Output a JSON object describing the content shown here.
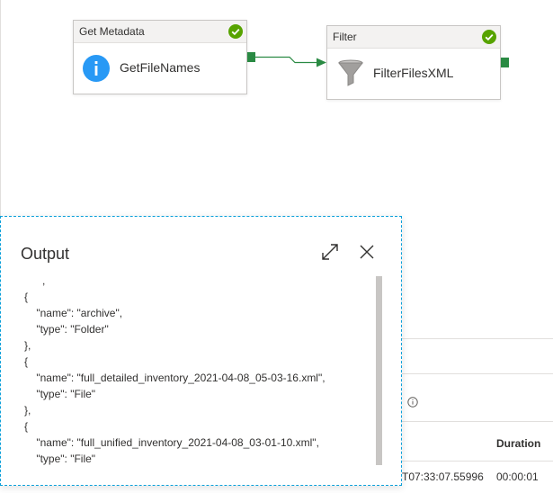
{
  "pipeline": {
    "activities": [
      {
        "type_label": "Get Metadata",
        "name": "GetFileNames",
        "status": "succeeded",
        "icon": "info-icon"
      },
      {
        "type_label": "Filter",
        "name": "FilterFilesXML",
        "status": "succeeded",
        "icon": "funnel-icon"
      }
    ]
  },
  "run_table": {
    "duration_header": "Duration",
    "row": {
      "time_fragment": "T07:33:07.55996",
      "duration": "00:00:01"
    }
  },
  "output_panel": {
    "title": "Output",
    "json_text": "      ,\n{\n    \"name\": \"archive\",\n    \"type\": \"Folder\"\n},\n{\n    \"name\": \"full_detailed_inventory_2021-04-08_05-03-16.xml\",\n    \"type\": \"File\"\n},\n{\n    \"name\": \"full_unified_inventory_2021-04-08_03-01-10.xml\",\n    \"type\": \"File\"\n}"
  },
  "colors": {
    "success": "#57a300",
    "connector": "#2a8a43",
    "info_blue": "#2899f5",
    "panel_border": "#0a9fd9"
  }
}
